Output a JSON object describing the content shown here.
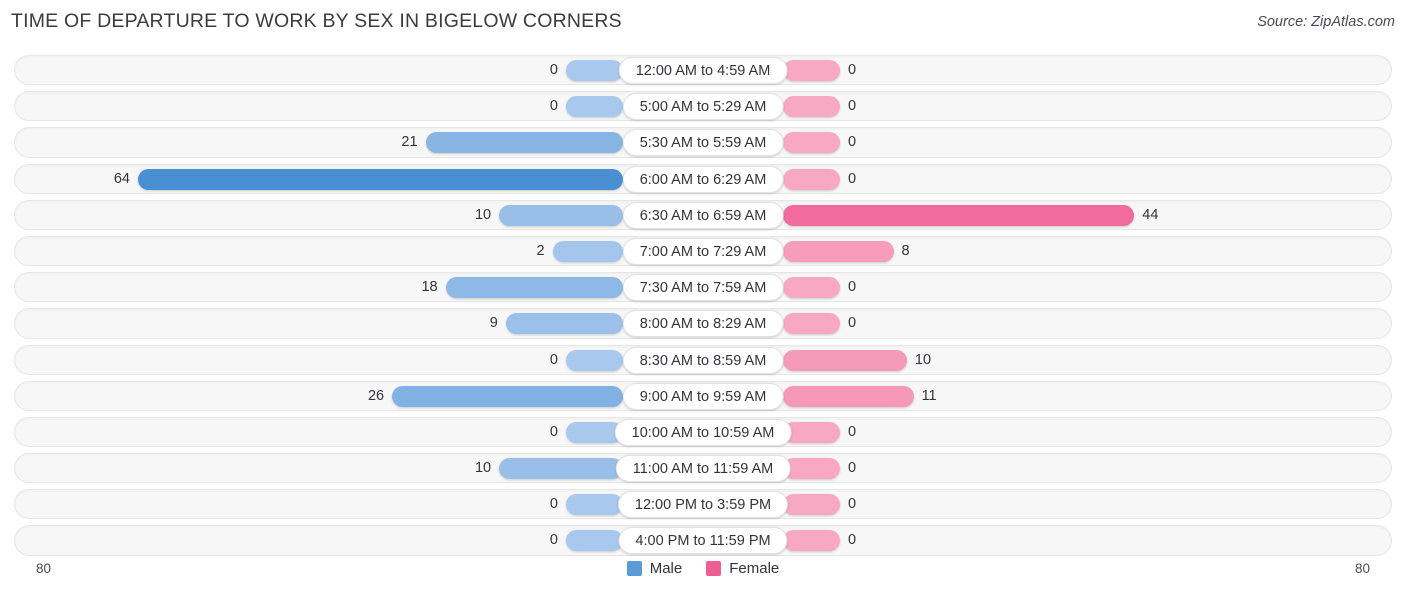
{
  "header": {
    "title": "TIME OF DEPARTURE TO WORK BY SEX IN BIGELOW CORNERS",
    "source": "Source: ZipAtlas.com"
  },
  "axis": {
    "left_max_label": "80",
    "right_max_label": "80"
  },
  "legend": {
    "male_label": "Male",
    "female_label": "Female",
    "male_color": "#5b9bd8",
    "female_color": "#ef5e93"
  },
  "colors": {
    "male_min": "#a8c8ed",
    "male_max": "#4a8fd4",
    "female_min": "#f8a8c3",
    "female_max": "#ee4f8a",
    "track_bg": "#f7f7f7",
    "track_border": "#e6e6e6",
    "text": "#33333c"
  },
  "chart_data": {
    "type": "bar",
    "subtype": "diverging-butterfly",
    "title": "TIME OF DEPARTURE TO WORK BY SEX IN BIGELOW CORNERS",
    "xlabel": "",
    "ylabel": "",
    "xlim": [
      80,
      80
    ],
    "grid": false,
    "legend_position": "bottom-center",
    "categories": [
      "12:00 AM to 4:59 AM",
      "5:00 AM to 5:29 AM",
      "5:30 AM to 5:59 AM",
      "6:00 AM to 6:29 AM",
      "6:30 AM to 6:59 AM",
      "7:00 AM to 7:29 AM",
      "7:30 AM to 7:59 AM",
      "8:00 AM to 8:29 AM",
      "8:30 AM to 8:59 AM",
      "9:00 AM to 9:59 AM",
      "10:00 AM to 10:59 AM",
      "11:00 AM to 11:59 AM",
      "12:00 PM to 3:59 PM",
      "4:00 PM to 11:59 PM"
    ],
    "series": [
      {
        "name": "Male",
        "direction": "left",
        "color": "#5b9bd8",
        "values": [
          0,
          0,
          21,
          64,
          10,
          2,
          18,
          9,
          0,
          26,
          0,
          10,
          0,
          0
        ]
      },
      {
        "name": "Female",
        "direction": "right",
        "color": "#ef5e93",
        "values": [
          0,
          0,
          0,
          0,
          44,
          8,
          0,
          0,
          10,
          11,
          0,
          0,
          0,
          0
        ]
      }
    ]
  }
}
